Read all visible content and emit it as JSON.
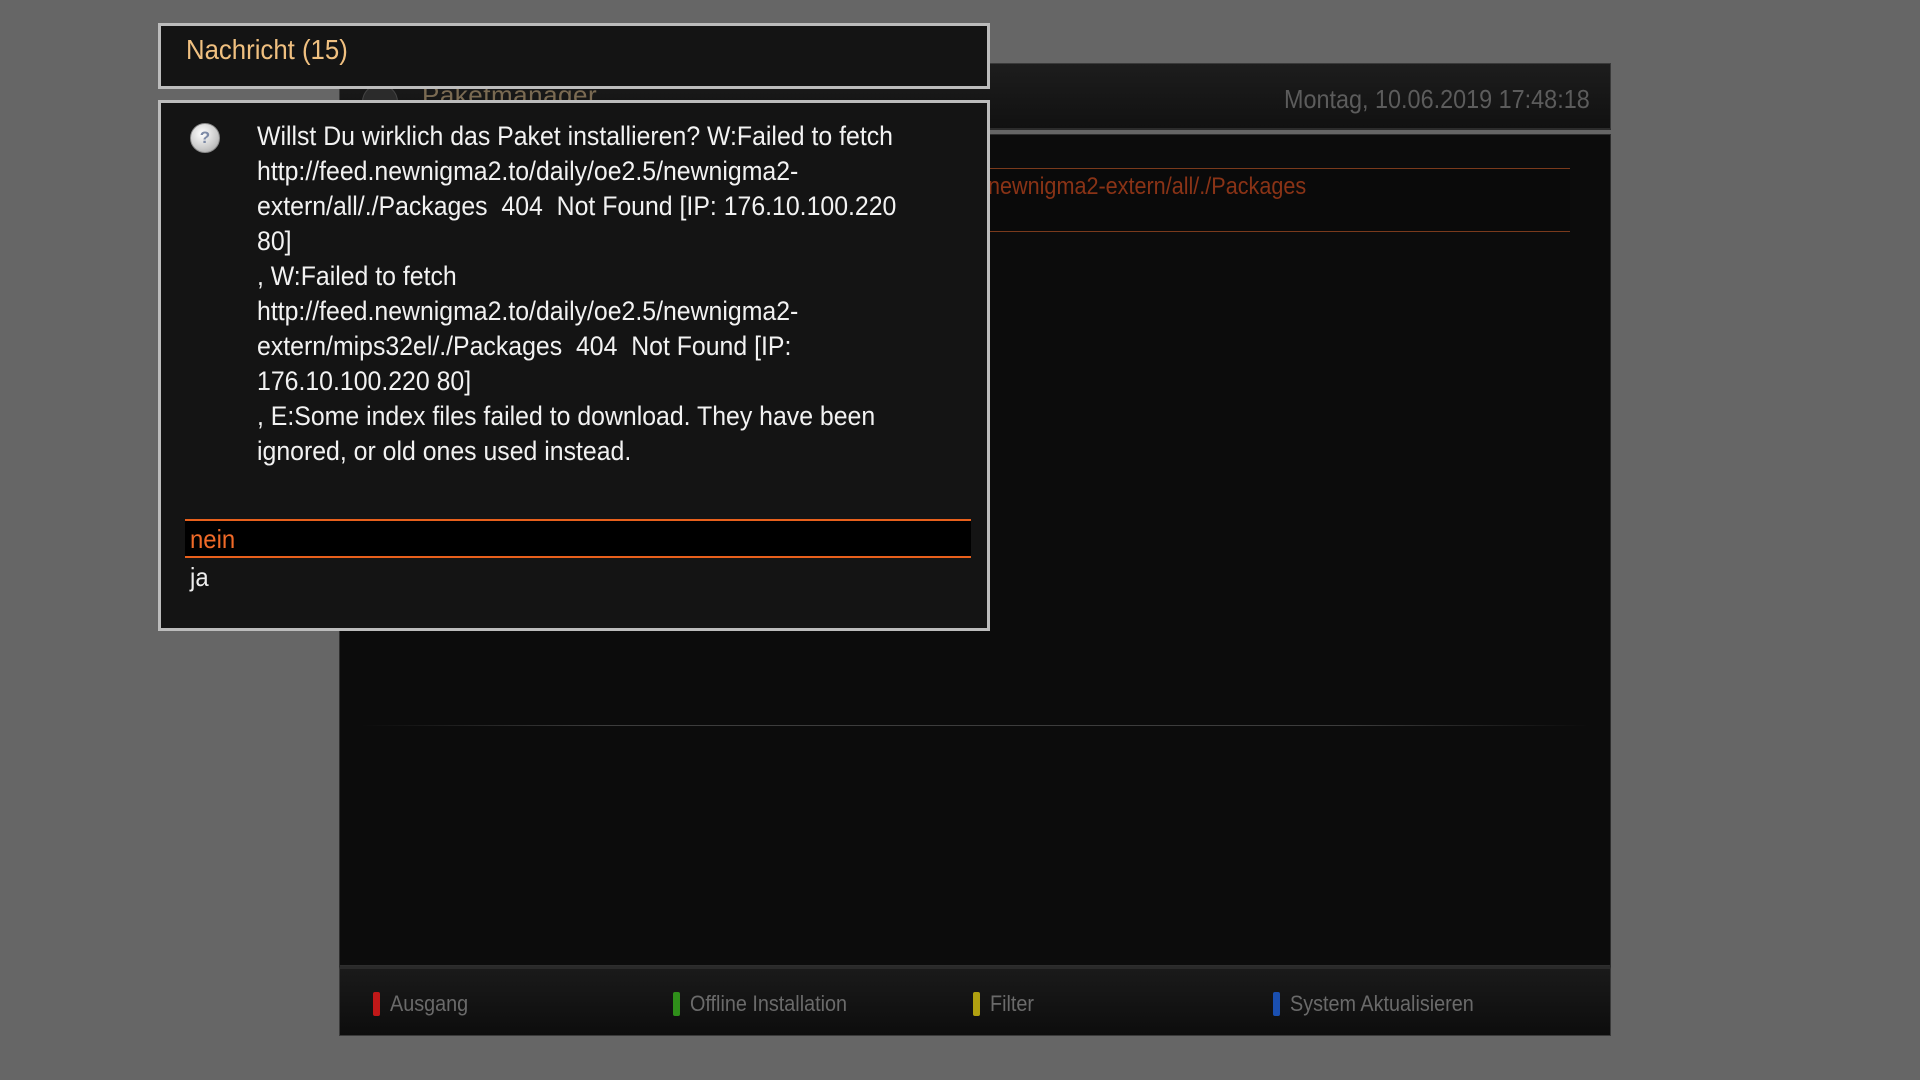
{
  "background_screen": {
    "title": "Paketmanager",
    "datetime": "Montag, 10.06.2019  17:48:18",
    "list_item": "newnigma2-extern/all/./Packages"
  },
  "footer": {
    "buttons": [
      {
        "label": "Ausgang",
        "color": "#c01818"
      },
      {
        "label": "Offline Installation",
        "color": "#2f8f1a"
      },
      {
        "label": "Filter",
        "color": "#b0a010"
      },
      {
        "label": "System Aktualisieren",
        "color": "#1a4fb0"
      }
    ]
  },
  "dialog": {
    "title": "Nachricht (15)",
    "icon": "question-icon",
    "message_lines": [
      "Willst Du wirklich das Paket installieren? W:Failed to fetch",
      "http://feed.newnigma2.to/daily/oe2.5/newnigma2-",
      "extern/all/./Packages  404  Not Found [IP: 176.10.100.220",
      "80]",
      ", W:Failed to fetch",
      "http://feed.newnigma2.to/daily/oe2.5/newnigma2-",
      "extern/mips32el/./Packages  404  Not Found [IP:",
      "176.10.100.220 80]",
      ", E:Some index files failed to download. They have been",
      "ignored, or old ones used instead."
    ],
    "choices": [
      {
        "label": "nein",
        "selected": true
      },
      {
        "label": "ja",
        "selected": false
      }
    ]
  },
  "colors": {
    "accent": "#e8601c",
    "title_text": "#f0c080",
    "dialog_border": "#bcbcbc",
    "background": "#666666"
  }
}
